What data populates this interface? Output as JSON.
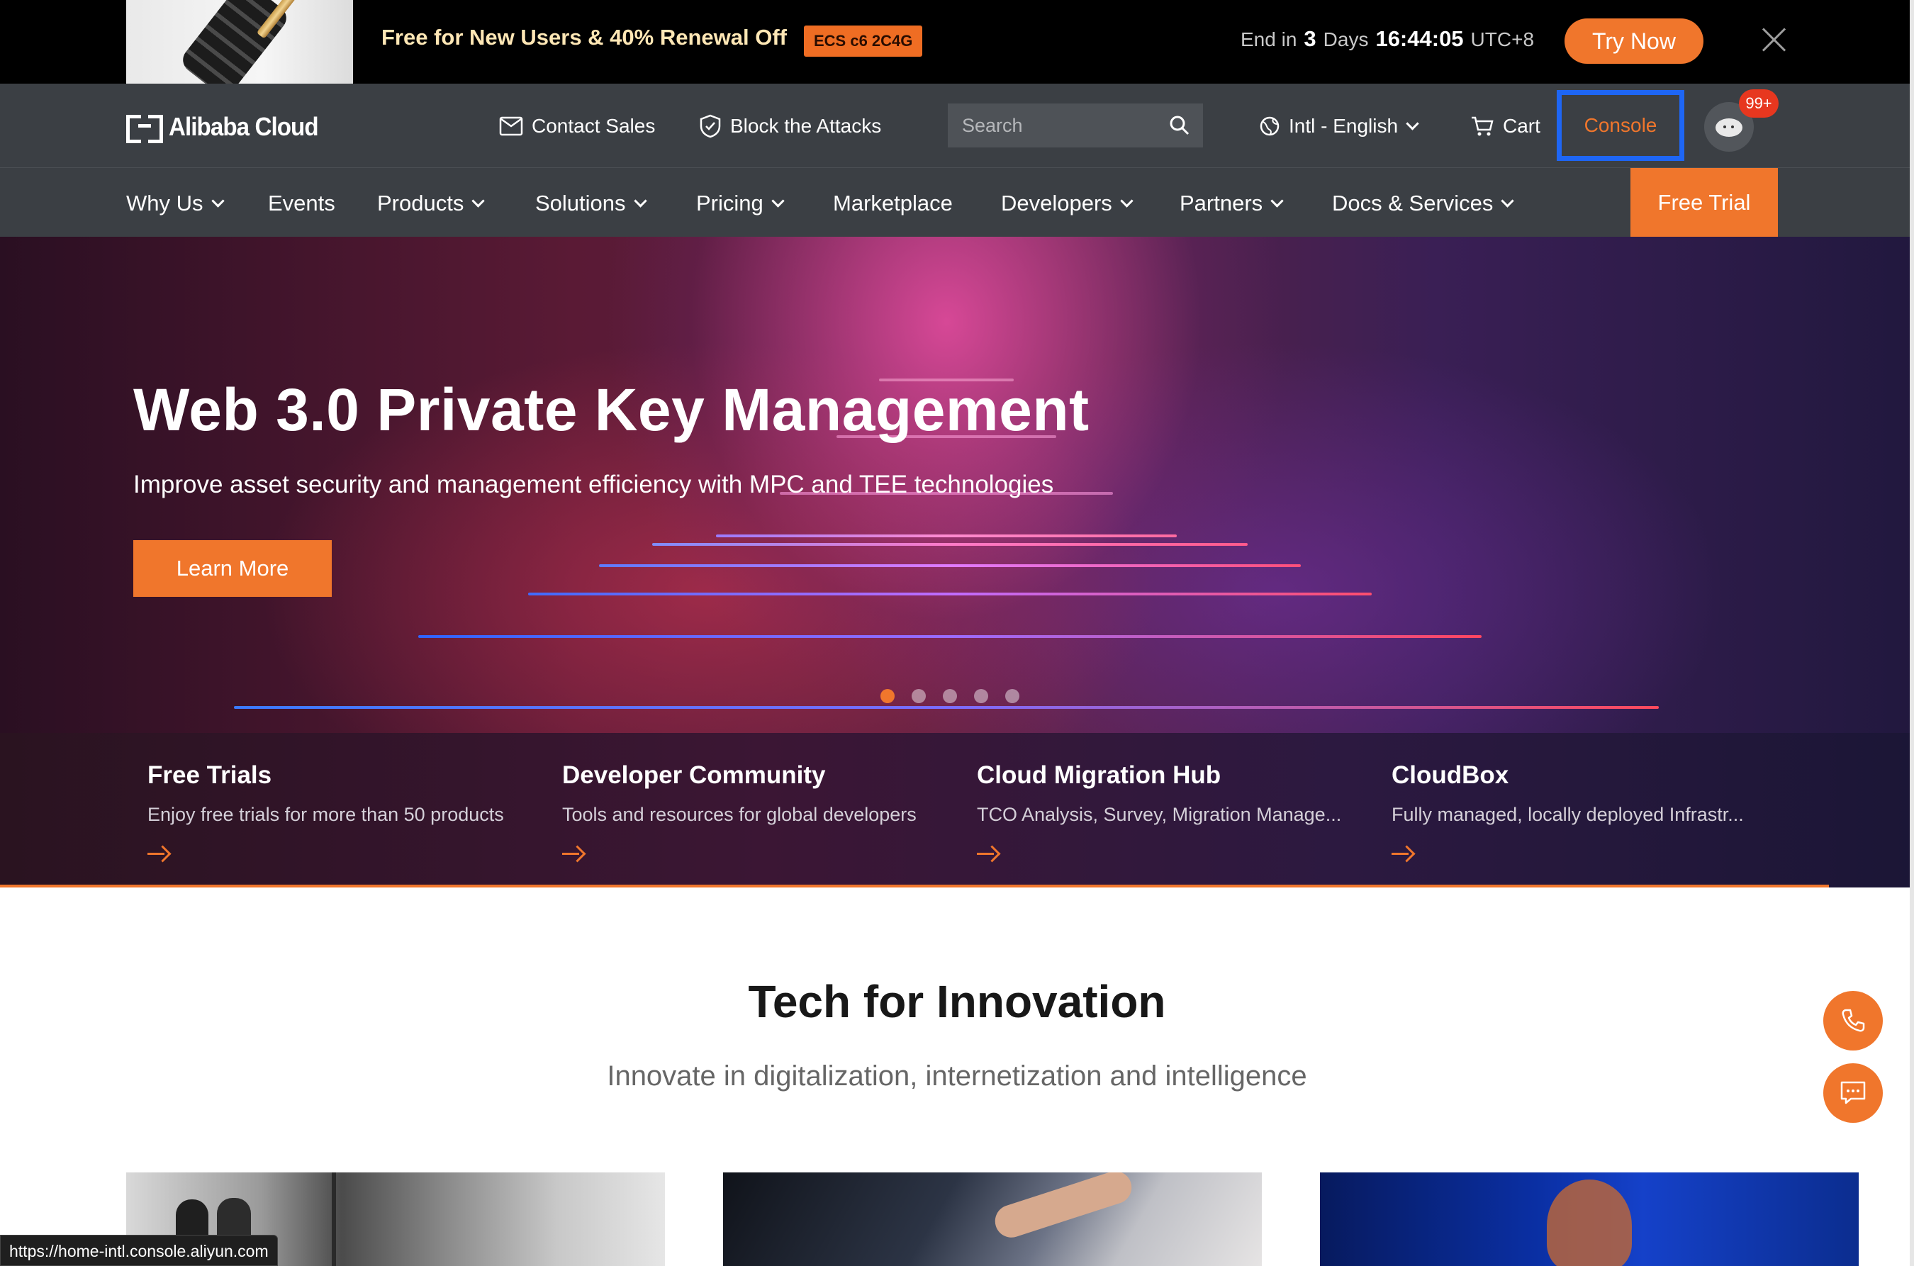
{
  "promo": {
    "text": "Free for New Users & 40% Renewal Off",
    "badge": "ECS c6 2C4G",
    "countdown_prefix": "End in",
    "days": "3",
    "days_label": "Days",
    "time": "16:44:05",
    "timezone": "UTC+8",
    "cta": "Try Now",
    "close_icon": "close-icon"
  },
  "topnav": {
    "logo": "Alibaba Cloud",
    "contact_sales": "Contact Sales",
    "block_attacks": "Block the Attacks",
    "search_placeholder": "Search",
    "language": "Intl - English",
    "cart": "Cart",
    "console": "Console",
    "notification_count": "99+"
  },
  "mainnav": {
    "items": [
      "Why Us",
      "Events",
      "Products",
      "Solutions",
      "Pricing",
      "Marketplace",
      "Developers",
      "Partners",
      "Docs & Services"
    ],
    "free_trial": "Free Trial"
  },
  "hero": {
    "title": "Web 3.0 Private Key Management",
    "subtitle": "Improve asset security and management efficiency with MPC and TEE technologies",
    "cta": "Learn More",
    "slide_count": 5,
    "active_slide": 1
  },
  "quick_links": [
    {
      "title": "Free Trials",
      "desc": "Enjoy free trials for more than 50 products"
    },
    {
      "title": "Developer Community",
      "desc": "Tools and resources for global developers"
    },
    {
      "title": "Cloud Migration Hub",
      "desc": "TCO Analysis, Survey, Migration Manage..."
    },
    {
      "title": "CloudBox",
      "desc": "Fully managed, locally deployed Infrastr..."
    }
  ],
  "tech": {
    "title": "Tech for Innovation",
    "subtitle": "Innovate in digitalization, internetization and intelligence"
  },
  "statusbar": {
    "url": "https://home-intl.console.aliyun.com"
  },
  "colors": {
    "accent": "#f0762c",
    "nav_bg": "#3b3f44",
    "console_highlight": "#1e66f5"
  }
}
